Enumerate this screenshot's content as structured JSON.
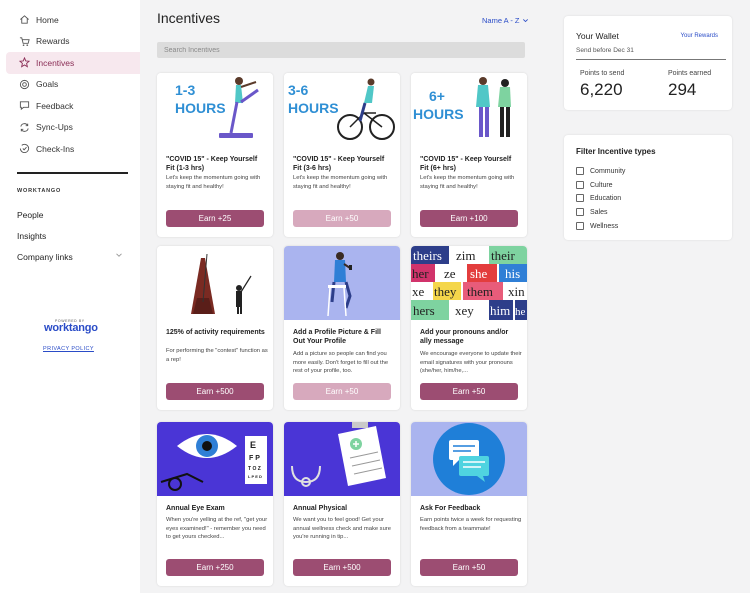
{
  "sidebar": {
    "nav": [
      {
        "label": "Home",
        "icon": "home-icon"
      },
      {
        "label": "Rewards",
        "icon": "cart-icon"
      },
      {
        "label": "Incentives",
        "icon": "star-icon",
        "active": true
      },
      {
        "label": "Goals",
        "icon": "target-icon"
      },
      {
        "label": "Feedback",
        "icon": "chat-icon"
      },
      {
        "label": "Sync-Ups",
        "icon": "sync-icon"
      },
      {
        "label": "Check-Ins",
        "icon": "checkin-icon"
      }
    ],
    "section_title": "WORKTANGO",
    "links": {
      "people": "People",
      "insights": "Insights",
      "company_links": "Company links"
    },
    "powered_by": "POWERED BY",
    "brand": "worktango",
    "privacy": "PRIVACY POLICY"
  },
  "main": {
    "title": "Incentives",
    "sort_label": "Name A - Z",
    "search_placeholder": "Search Incentives"
  },
  "cards": [
    {
      "title": "\"COVID 15\" - Keep Yourself Fit (1-3 hrs)",
      "desc": "Let's keep the momentum going with staying fit and healthy!",
      "button": "Earn +25",
      "enabled": true,
      "image_text": "1-3 HOURS"
    },
    {
      "title": "\"COVID 15\" - Keep Yourself Fit (3-6 hrs)",
      "desc": "Let's keep the momentum going with staying fit and healthy!",
      "button": "Earn +50",
      "enabled": false,
      "image_text": "3-6 HOURS"
    },
    {
      "title": "\"COVID 15\" - Keep Yourself Fit (6+ hrs)",
      "desc": "Let's keep the momentum going with staying fit and healthy!",
      "button": "Earn +100",
      "enabled": true,
      "image_text": "6+ HOURS"
    },
    {
      "title": "125% of activity requirements",
      "desc": "For performing the \"contest\" function as a rep!",
      "button": "Earn +500",
      "enabled": true
    },
    {
      "title": "Add a Profile Picture & Fill Out Your Profile",
      "desc": "Add a picture so people can find you more easily. Don't forget to fill out the rest of your profile, too.",
      "button": "Earn +50",
      "enabled": false
    },
    {
      "title": "Add your pronouns and/or ally message",
      "desc": "We encourage everyone to update their email signatures with your pronouns (she/her, him/he,...",
      "button": "Earn +50",
      "enabled": true,
      "image_words": [
        "theirs",
        "zim",
        "their",
        "her",
        "ze",
        "she",
        "his",
        "xe",
        "they",
        "them",
        "xin",
        "hers",
        "xey",
        "him",
        "he"
      ]
    },
    {
      "title": "Annual Eye Exam",
      "desc": "When you're yelling at the ref, \"get your eyes examined!\" - remember you need to get yours checked...",
      "button": "Earn +250",
      "enabled": true
    },
    {
      "title": "Annual Physical",
      "desc": "We want you to feel good! Get your annual wellness check and make sure you're running in tip...",
      "button": "Earn +500",
      "enabled": true
    },
    {
      "title": "Ask For Feedback",
      "desc": "Earn points twice a week for requesting feedback from a teammate!",
      "button": "Earn +50",
      "enabled": true
    }
  ],
  "wallet": {
    "title": "Your Wallet",
    "link": "Your Rewards",
    "subtitle": "Send before Dec 31",
    "send_label": "Points to send",
    "send_value": "6,220",
    "earned_label": "Points earned",
    "earned_value": "294"
  },
  "filter": {
    "title": "Filter Incentive types",
    "options": [
      "Community",
      "Culture",
      "Education",
      "Sales",
      "Wellness"
    ]
  },
  "colors": {
    "accent": "#9c4d72",
    "accent_disabled": "#d7a9bd",
    "link": "#2a4cc7",
    "active_bg": "#f7e8ee"
  }
}
